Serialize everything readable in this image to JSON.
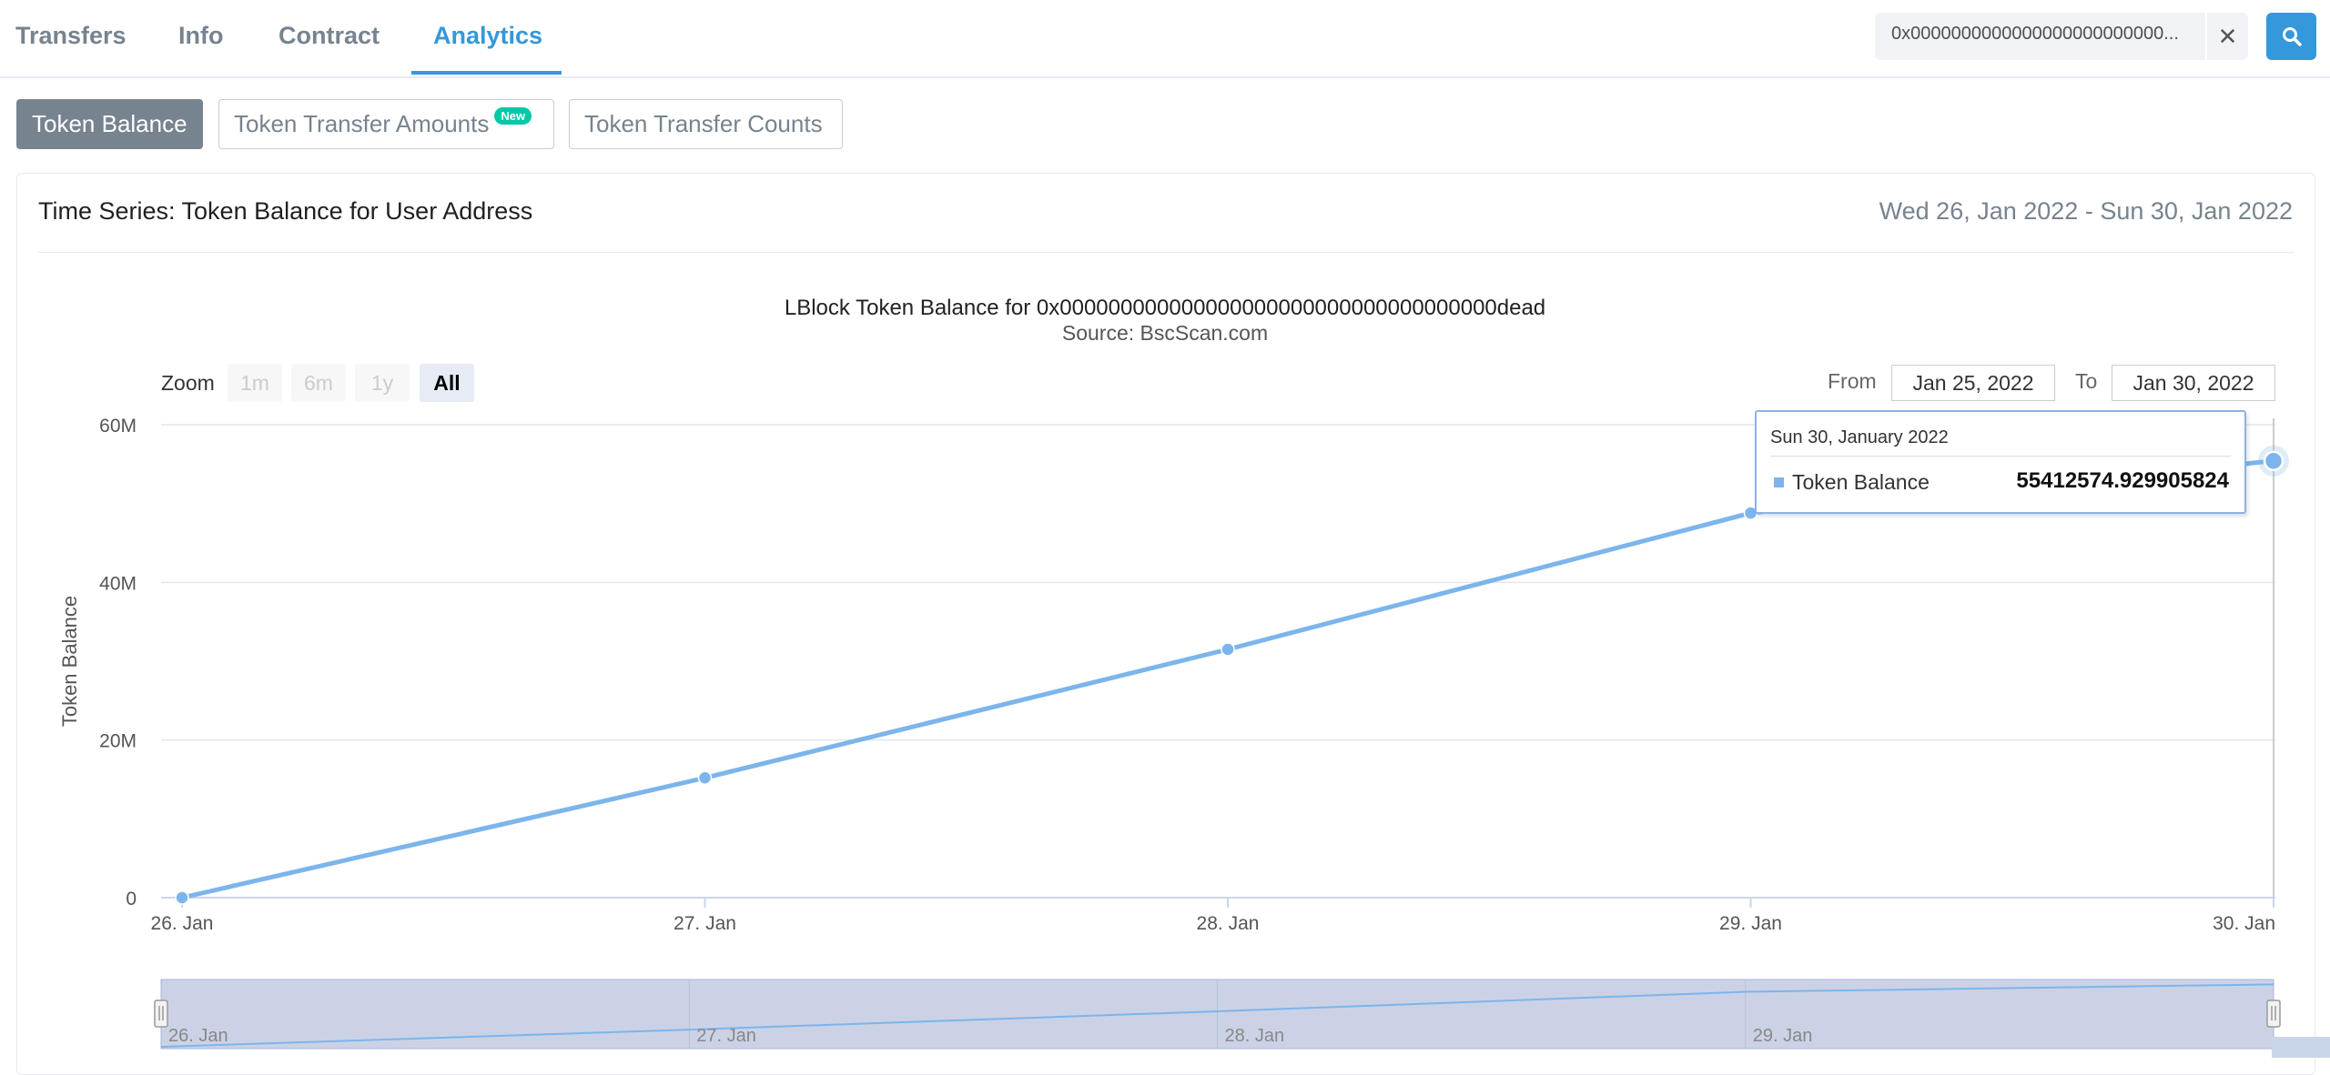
{
  "tabs": [
    "Transfers",
    "Info",
    "Contract",
    "Analytics"
  ],
  "search": {
    "value": "0x0000000000000000000000000..."
  },
  "subtabs": {
    "balance": "Token Balance",
    "amounts": "Token Transfer Amounts",
    "amounts_badge": "New",
    "counts": "Token Transfer Counts"
  },
  "card": {
    "title": "Time Series: Token Balance for User Address",
    "range": "Wed 26, Jan 2022 - Sun 30, Jan 2022"
  },
  "chart_text": {
    "title": "LBlock Token Balance for 0x000000000000000000000000000000000000dead",
    "subtitle": "Source: BscScan.com"
  },
  "zoom": {
    "label": "Zoom",
    "buttons": [
      "1m",
      "6m",
      "1y",
      "All"
    ]
  },
  "range_inputs": {
    "from_label": "From",
    "from": "Jan 25, 2022",
    "to_label": "To",
    "to": "Jan 30, 2022"
  },
  "tooltip": {
    "date": "Sun 30, January 2022",
    "series": "Token Balance",
    "value": "55412574.929905824"
  },
  "chart_data": {
    "type": "line",
    "x": [
      "26. Jan",
      "27. Jan",
      "28. Jan",
      "29. Jan",
      "30. Jan"
    ],
    "series": [
      {
        "name": "Token Balance",
        "values": [
          0,
          15200000,
          31500000,
          48800000,
          55412574.929905824
        ]
      }
    ],
    "ylabel": "Token Balance",
    "ylim": [
      0,
      60000000
    ],
    "yticks": [
      "0",
      "20M",
      "40M",
      "60M"
    ],
    "navigator_labels": [
      "26. Jan",
      "27. Jan",
      "28. Jan",
      "29. Jan"
    ],
    "grid": true,
    "color": "#7cb5ec"
  }
}
